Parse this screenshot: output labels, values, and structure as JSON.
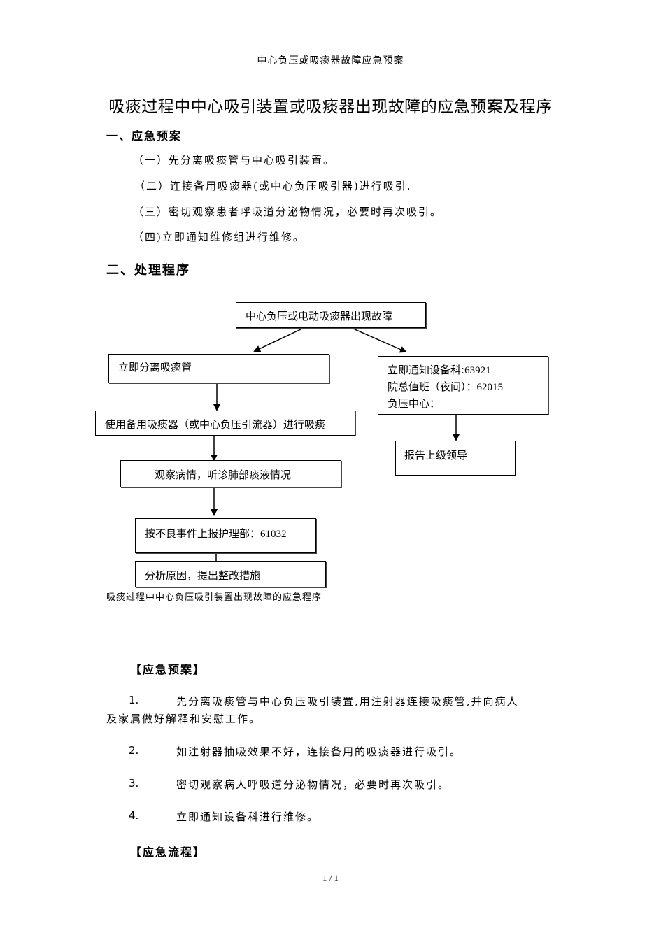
{
  "header": {
    "text": "中心负压或吸痰器故障应急预案"
  },
  "title": "吸痰过程中中心吸引装置或吸痰器出现故障的应急预案及程序",
  "section1": {
    "heading": "一、应急预案",
    "items": [
      "（一）先分离吸痰管与中心吸引装置。",
      "（二）连接备用吸痰器(或中心负压吸引器)进行吸引.",
      "（三）密切观察患者呼吸道分泌物情况，必要时再次吸引。",
      "（四)立即通知维修组进行维修。"
    ]
  },
  "section2": {
    "heading": "二、处理程序"
  },
  "flowchart": {
    "top": "中心负压或电动吸痰器出现故障",
    "left1": "立即分离吸痰管",
    "left2": "使用备用吸痰器（或中心负压引流器）进行吸痰",
    "left3": "观察病情，听诊肺部痰液情况",
    "left4_label": "按不良事件上报护理部：",
    "left4_num": "61032",
    "left5": "分析原因，提出整改措施",
    "right1_line1_label": "立即通知设备科:",
    "right1_line1_num": "63921",
    "right1_line2_label": "院总值班（夜间）：",
    "right1_line2_num": "62015",
    "right1_line3": "负压中心：",
    "right2": "报告上级领导"
  },
  "caption": "吸痰过程中中心负压吸引装置出现故障的应急程序",
  "plan": {
    "heading": "【应急预案】",
    "items": [
      {
        "n": "1.",
        "text": "先分离吸痰管与中心负压吸引装置,用注射器连接吸痰管,并向病人",
        "cont": "及家属做好解释和安慰工作。"
      },
      {
        "n": "2.",
        "text": "如注射器抽吸效果不好，连接备用的吸痰器进行吸引。"
      },
      {
        "n": "3.",
        "text": "密切观察病人呼吸道分泌物情况，必要时再次吸引。"
      },
      {
        "n": "4.",
        "text": "立即通知设备科进行维修。"
      }
    ]
  },
  "flow_heading": "【应急流程】",
  "footer": {
    "page": "1 / 1"
  }
}
